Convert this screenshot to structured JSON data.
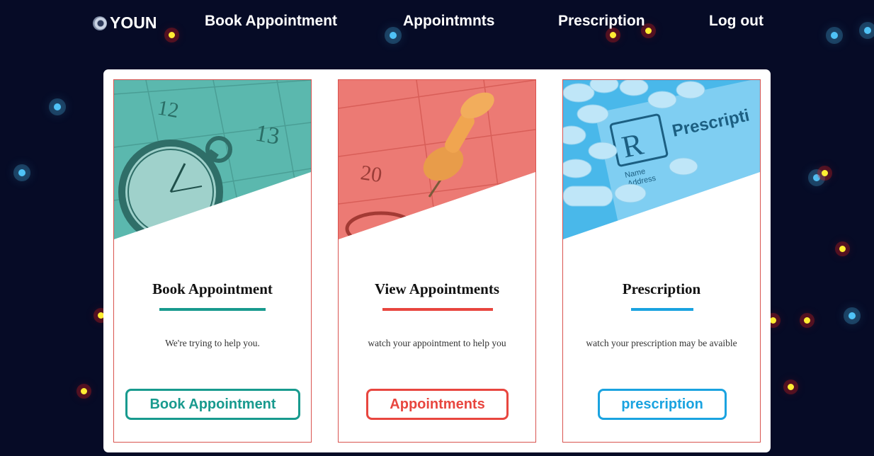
{
  "nav": {
    "logo_text": "YOUN",
    "links": [
      "Book Appointment",
      "Appointmnts",
      "Prescription",
      "Log out"
    ]
  },
  "cards": [
    {
      "title": "Book Appointment",
      "description": "We're trying to help you.",
      "button_label": "Book Appointment",
      "accent": "#189a8e",
      "image_icon": "pocket-watch-calendar"
    },
    {
      "title": "View Appointments",
      "description": "watch your appointment to help you",
      "button_label": "Appointments",
      "accent": "#e8463f",
      "image_icon": "calendar-pushpin"
    },
    {
      "title": "Prescription",
      "description": "watch your prescription may be avaible",
      "button_label": "prescription",
      "accent": "#1aa3e0",
      "image_icon": "rx-prescription-pills"
    }
  ],
  "card_images": {
    "book": {
      "numbers": [
        "12",
        "13"
      ]
    },
    "view": {
      "numbers": [
        "20"
      ]
    },
    "prescription": {
      "rx": "R",
      "heading": "Prescripti",
      "fields": [
        "Name",
        "Address"
      ]
    }
  },
  "colors": {
    "background": "#060b26",
    "glow_blue": "#4fc3f7",
    "glow_yellow": "#ffee33",
    "card_border": "#d9534f"
  }
}
